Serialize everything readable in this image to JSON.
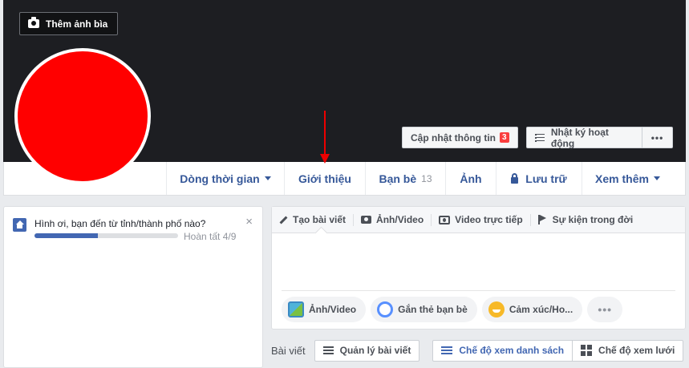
{
  "cover": {
    "add_cover_label": "Thêm ảnh bìa",
    "update_info_label": "Cập nhật thông tin",
    "update_info_badge": "3",
    "activity_log_label": "Nhật ký hoạt động",
    "more_label": "•••"
  },
  "nav": {
    "timeline": "Dòng thời gian",
    "about": "Giới thiệu",
    "friends": "Bạn bè",
    "friends_count": "13",
    "photos": "Ảnh",
    "archive": "Lưu trữ",
    "more": "Xem thêm"
  },
  "hometown_prompt": {
    "question": "Hình ơi, bạn đến từ tỉnh/thành phố nào?",
    "progress_label": "Hoàn tất 4/9",
    "progress_fraction": 0.444,
    "close": "×"
  },
  "composer": {
    "tabs": {
      "create_post": "Tạo bài viết",
      "photo_video": "Ảnh/Video",
      "live_video": "Video trực tiếp",
      "life_event": "Sự kiện trong đời"
    },
    "actions": {
      "photo_video": "Ảnh/Video",
      "tag_friends": "Gắn thẻ bạn bè",
      "feeling": "Cảm xúc/Ho...",
      "more": "•••"
    }
  },
  "posts": {
    "label": "Bài viết",
    "manage": "Quản lý bài viết",
    "list_view": "Chế độ xem danh sách",
    "grid_view": "Chế độ xem lưới"
  },
  "colors": {
    "avatar": "#ff0000",
    "accent": "#4267b2",
    "annotation_arrow": "#ee0000"
  }
}
